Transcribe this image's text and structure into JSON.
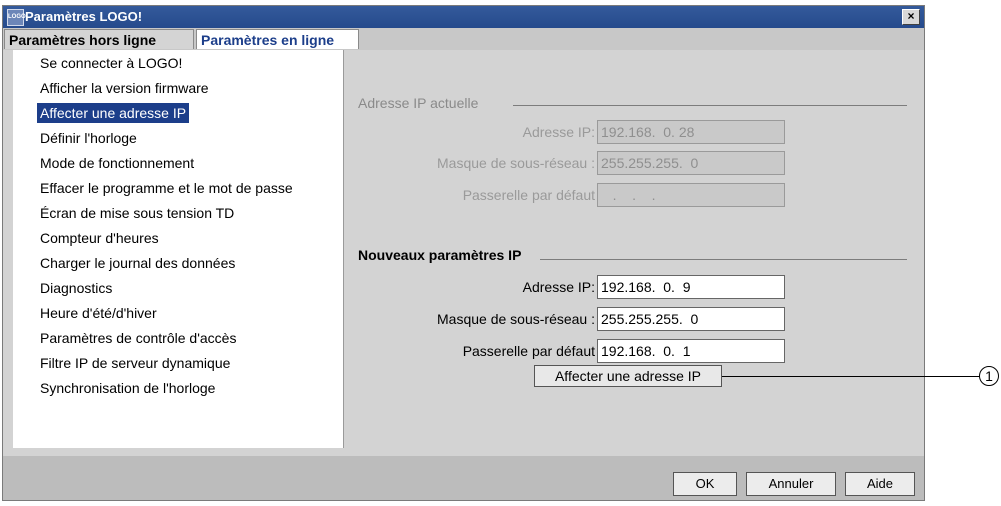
{
  "window": {
    "title": "Paramètres LOGO!",
    "icon_text": "LOGO",
    "close_symbol": "×"
  },
  "tabs": [
    {
      "label": "Paramètres hors ligne",
      "active": false
    },
    {
      "label": "Paramètres en ligne",
      "active": true
    }
  ],
  "sidebar": {
    "items": [
      {
        "label": "Se connecter à LOGO!"
      },
      {
        "label": "Afficher la version firmware"
      },
      {
        "label": "Affecter une adresse IP",
        "selected": true
      },
      {
        "label": "Définir l'horloge"
      },
      {
        "label": "Mode de fonctionnement"
      },
      {
        "label": "Effacer le programme et le mot de passe"
      },
      {
        "label": "Écran de mise sous tension TD"
      },
      {
        "label": "Compteur d'heures"
      },
      {
        "label": "Charger le journal des données"
      },
      {
        "label": "Diagnostics"
      },
      {
        "label": "Heure d'été/d'hiver"
      },
      {
        "label": "Paramètres de contrôle d'accès"
      },
      {
        "label": "Filtre IP de serveur dynamique"
      },
      {
        "label": "Synchronisation de l'horloge"
      }
    ]
  },
  "current_ip": {
    "group_label": "Adresse IP actuelle",
    "address_label": "Adresse IP:",
    "address_value": "192.168.  0. 28",
    "mask_label": "Masque de sous-réseau :",
    "mask_value": "255.255.255.  0",
    "gateway_label": "Passerelle par défaut",
    "gateway_value": "   .    .    ."
  },
  "new_ip": {
    "group_label": "Nouveaux paramètres IP",
    "address_label": "Adresse IP:",
    "address_value": "192.168.  0.  9",
    "mask_label": "Masque de sous-réseau :",
    "mask_value": "255.255.255.  0",
    "gateway_label": "Passerelle par défaut",
    "gateway_value": "192.168.  0.  1",
    "assign_button": "Affecter une adresse IP"
  },
  "footer": {
    "ok": "OK",
    "cancel": "Annuler",
    "help": "Aide"
  },
  "callout": {
    "number": "1"
  },
  "colors": {
    "title_bar": "#2f5597",
    "selection": "#1c3e8a",
    "active_tab_text": "#1c3e8a"
  }
}
